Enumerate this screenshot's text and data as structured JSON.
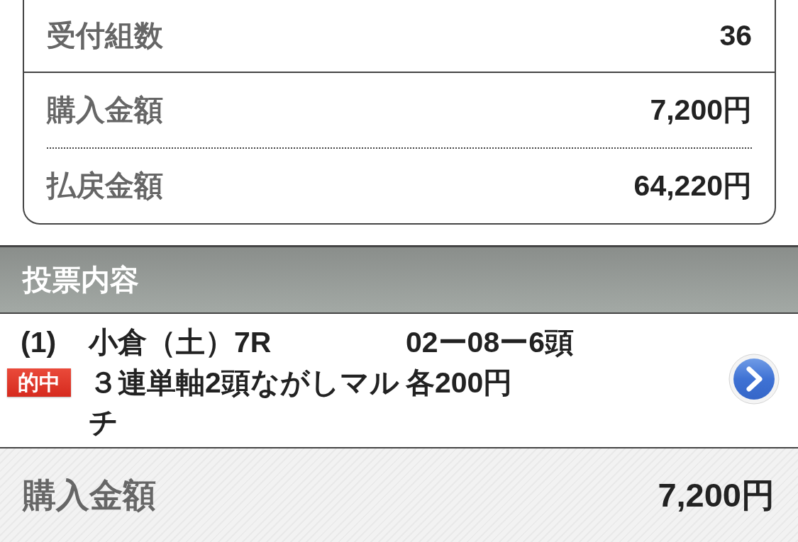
{
  "summary": {
    "groups": [
      [
        {
          "label": "受付組数",
          "value": "36"
        }
      ],
      [
        {
          "label": "購入金額",
          "value": "7,200円"
        },
        {
          "label": "払戻金額",
          "value": "64,220円"
        }
      ]
    ]
  },
  "section": {
    "title": "投票内容"
  },
  "bets": [
    {
      "number": "(1)",
      "badge": "的中",
      "venue": "小倉（土）7R",
      "bet_type": "３連単軸2頭ながしマルチ",
      "combination": "02ー08ー6頭",
      "amount": "各200円"
    }
  ],
  "total": {
    "label": "購入金額",
    "value": "7,200円"
  }
}
